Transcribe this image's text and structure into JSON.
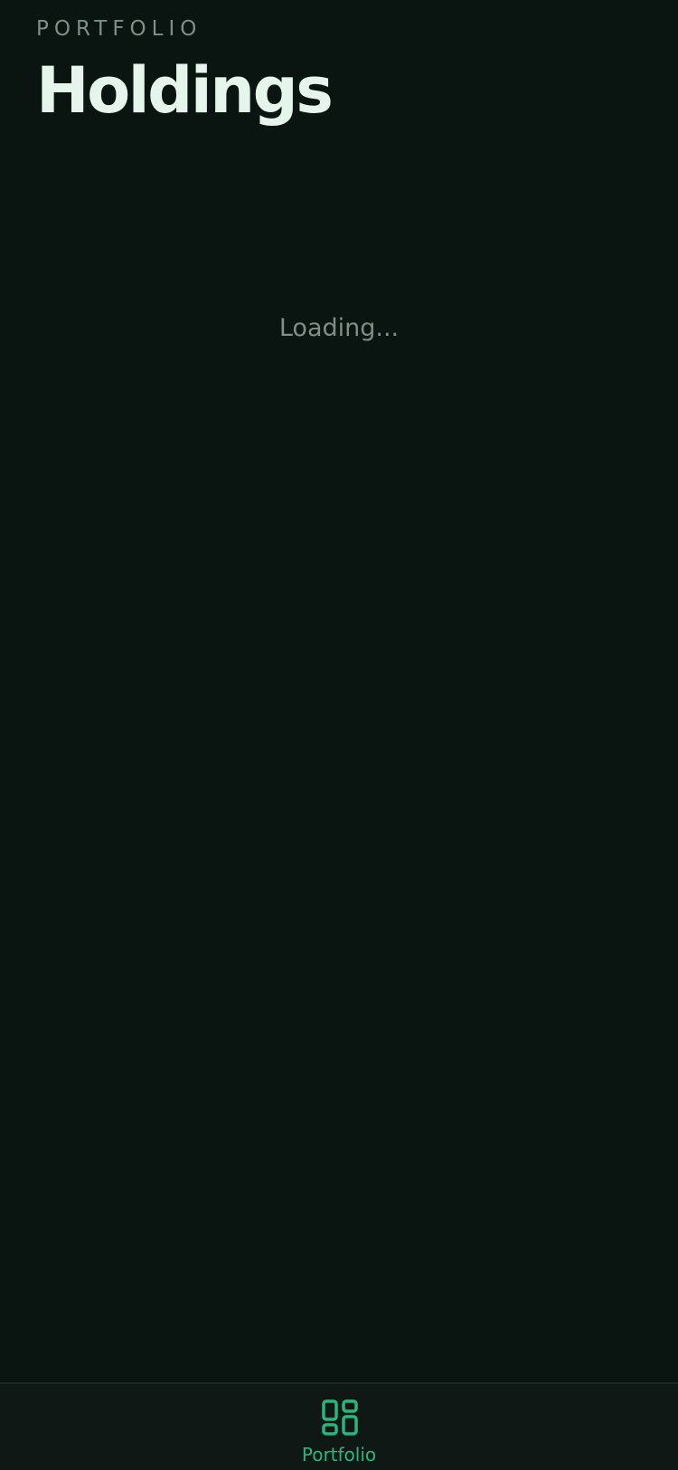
{
  "header": {
    "eyebrow": "PORTFOLIO",
    "title": "Holdings"
  },
  "main": {
    "status_text": "Loading..."
  },
  "tabbar": {
    "items": [
      {
        "label": "Portfolio",
        "icon": "dashboard-grid-icon",
        "active": true
      }
    ]
  },
  "colors": {
    "background": "#0a1410",
    "tabbar_background": "#101816",
    "accent": "#2bb57d",
    "title_text": "#e6f5ec",
    "muted_text": "#7d8f86"
  }
}
